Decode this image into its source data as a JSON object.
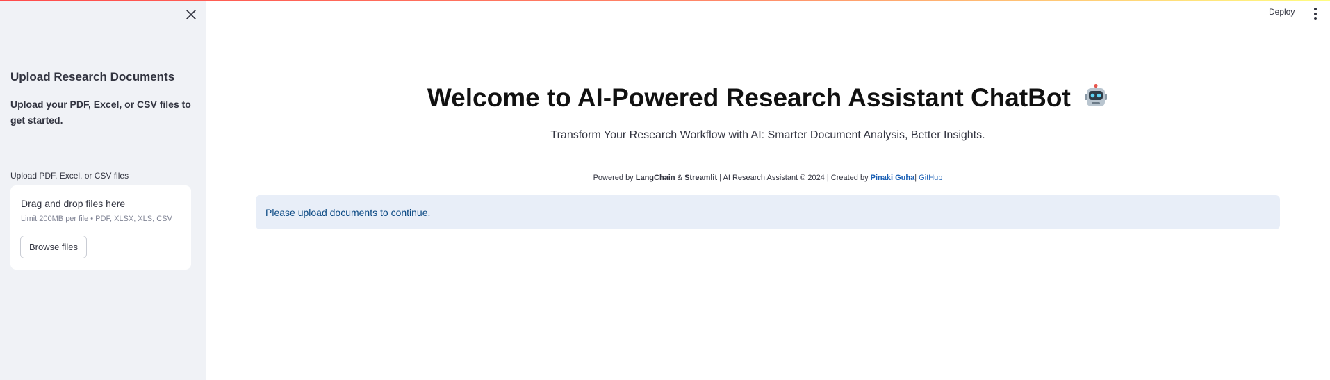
{
  "sidebar": {
    "title": "Upload Research Documents",
    "description": "Upload your PDF, Excel, or CSV files to get started.",
    "uploader": {
      "label": "Upload PDF, Excel, or CSV files",
      "drop_text": "Drag and drop files here",
      "limit_text": "Limit 200MB per file • PDF, XLSX, XLS, CSV",
      "browse_label": "Browse files"
    }
  },
  "header": {
    "deploy_label": "Deploy"
  },
  "main": {
    "title": "Welcome to AI-Powered Research Assistant ChatBot",
    "title_icon": "robot-icon",
    "subtitle": "Transform Your Research Workflow with AI: Smarter Document Analysis, Better Insights.",
    "footer": {
      "powered_prefix": "Powered by",
      "langchain": "LangChain",
      "amp": "&",
      "streamlit": "Streamlit",
      "middle": "| AI Research Assistant © 2024 | Created by",
      "author": "Pinaki Guha",
      "sep": "|",
      "github": "GitHub"
    },
    "info_message": "Please upload documents to continue."
  },
  "colors": {
    "sidebar_bg": "#f0f2f6",
    "info_bg": "#e8eef8",
    "info_text": "#0c4a84",
    "link": "#1a5fb4",
    "accent_red": "#ff4b4b"
  }
}
